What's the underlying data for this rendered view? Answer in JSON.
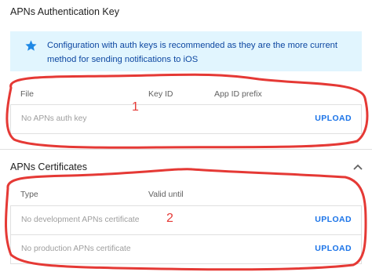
{
  "auth_key": {
    "title": "APNs Authentication Key",
    "info": {
      "icon": "star-icon",
      "text": "Configuration with auth keys is recommended as they are the more current method for sending notifications to iOS"
    },
    "columns": [
      "File",
      "Key ID",
      "App ID prefix"
    ],
    "row": {
      "label": "No APNs auth key",
      "action": "UPLOAD"
    }
  },
  "certificates": {
    "title": "APNs Certificates",
    "collapse_icon": "chevron-up-icon",
    "columns": [
      "Type",
      "Valid until"
    ],
    "rows": [
      {
        "label": "No development APNs certificate",
        "action": "UPLOAD"
      },
      {
        "label": "No production APNs certificate",
        "action": "UPLOAD"
      }
    ]
  },
  "annotations": {
    "labels": [
      "1",
      "2"
    ],
    "color": "#e53935"
  },
  "colors": {
    "info_bg": "#e1f5fe",
    "info_text": "#0d47a1",
    "accent": "#1a73e8",
    "star": "#1e88e5"
  }
}
